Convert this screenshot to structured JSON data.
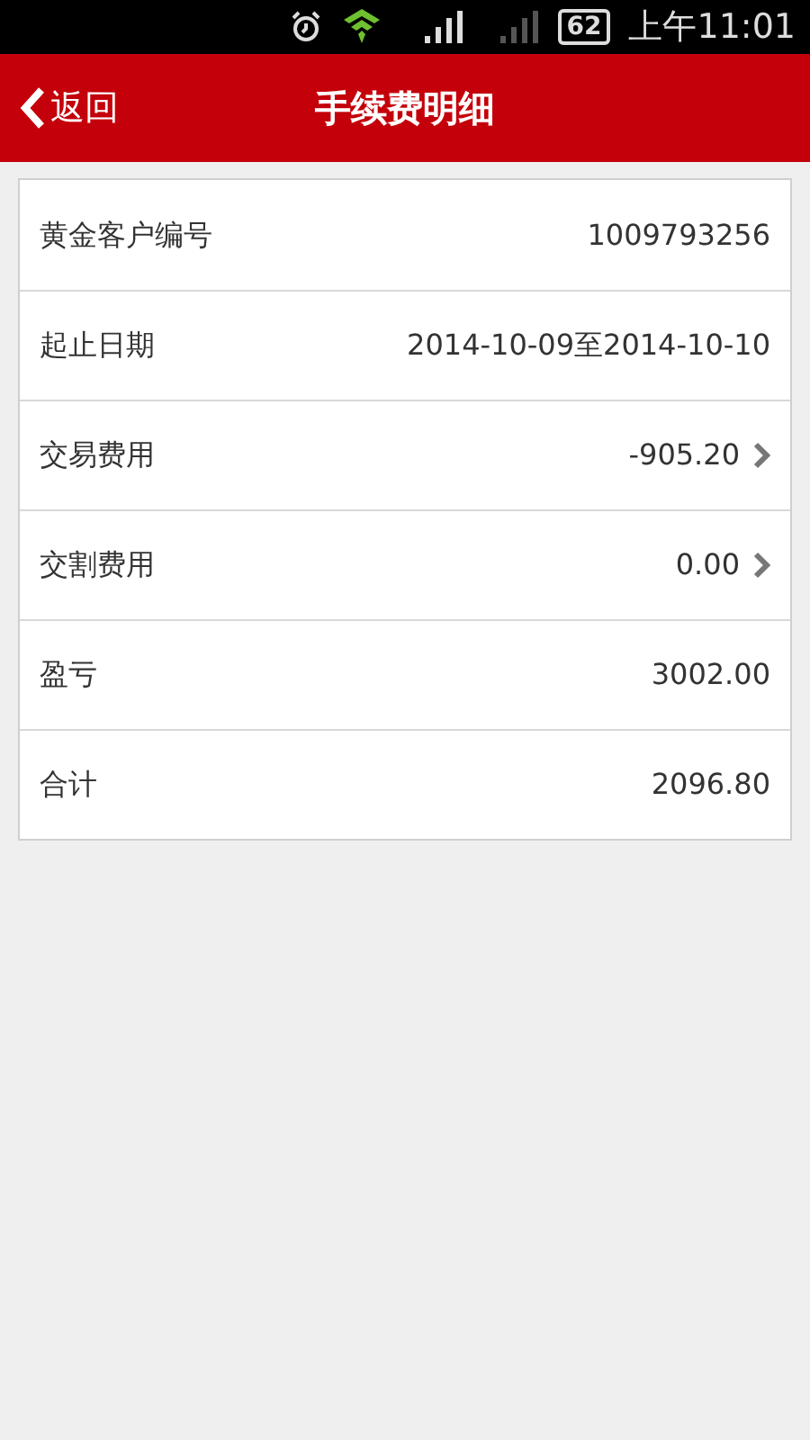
{
  "status_bar": {
    "battery": "62",
    "time": "上午11:01"
  },
  "header": {
    "back": "返回",
    "title": "手续费明细"
  },
  "rows": [
    {
      "label": "黄金客户编号",
      "value": "1009793256",
      "arrow": false
    },
    {
      "label": "起止日期",
      "value": "2014-10-09至2014-10-10",
      "arrow": false
    },
    {
      "label": "交易费用",
      "value": "-905.20",
      "arrow": true
    },
    {
      "label": "交割费用",
      "value": "0.00",
      "arrow": true
    },
    {
      "label": "盈亏",
      "value": "3002.00",
      "arrow": false
    },
    {
      "label": "合计",
      "value": "2096.80",
      "arrow": false
    }
  ]
}
